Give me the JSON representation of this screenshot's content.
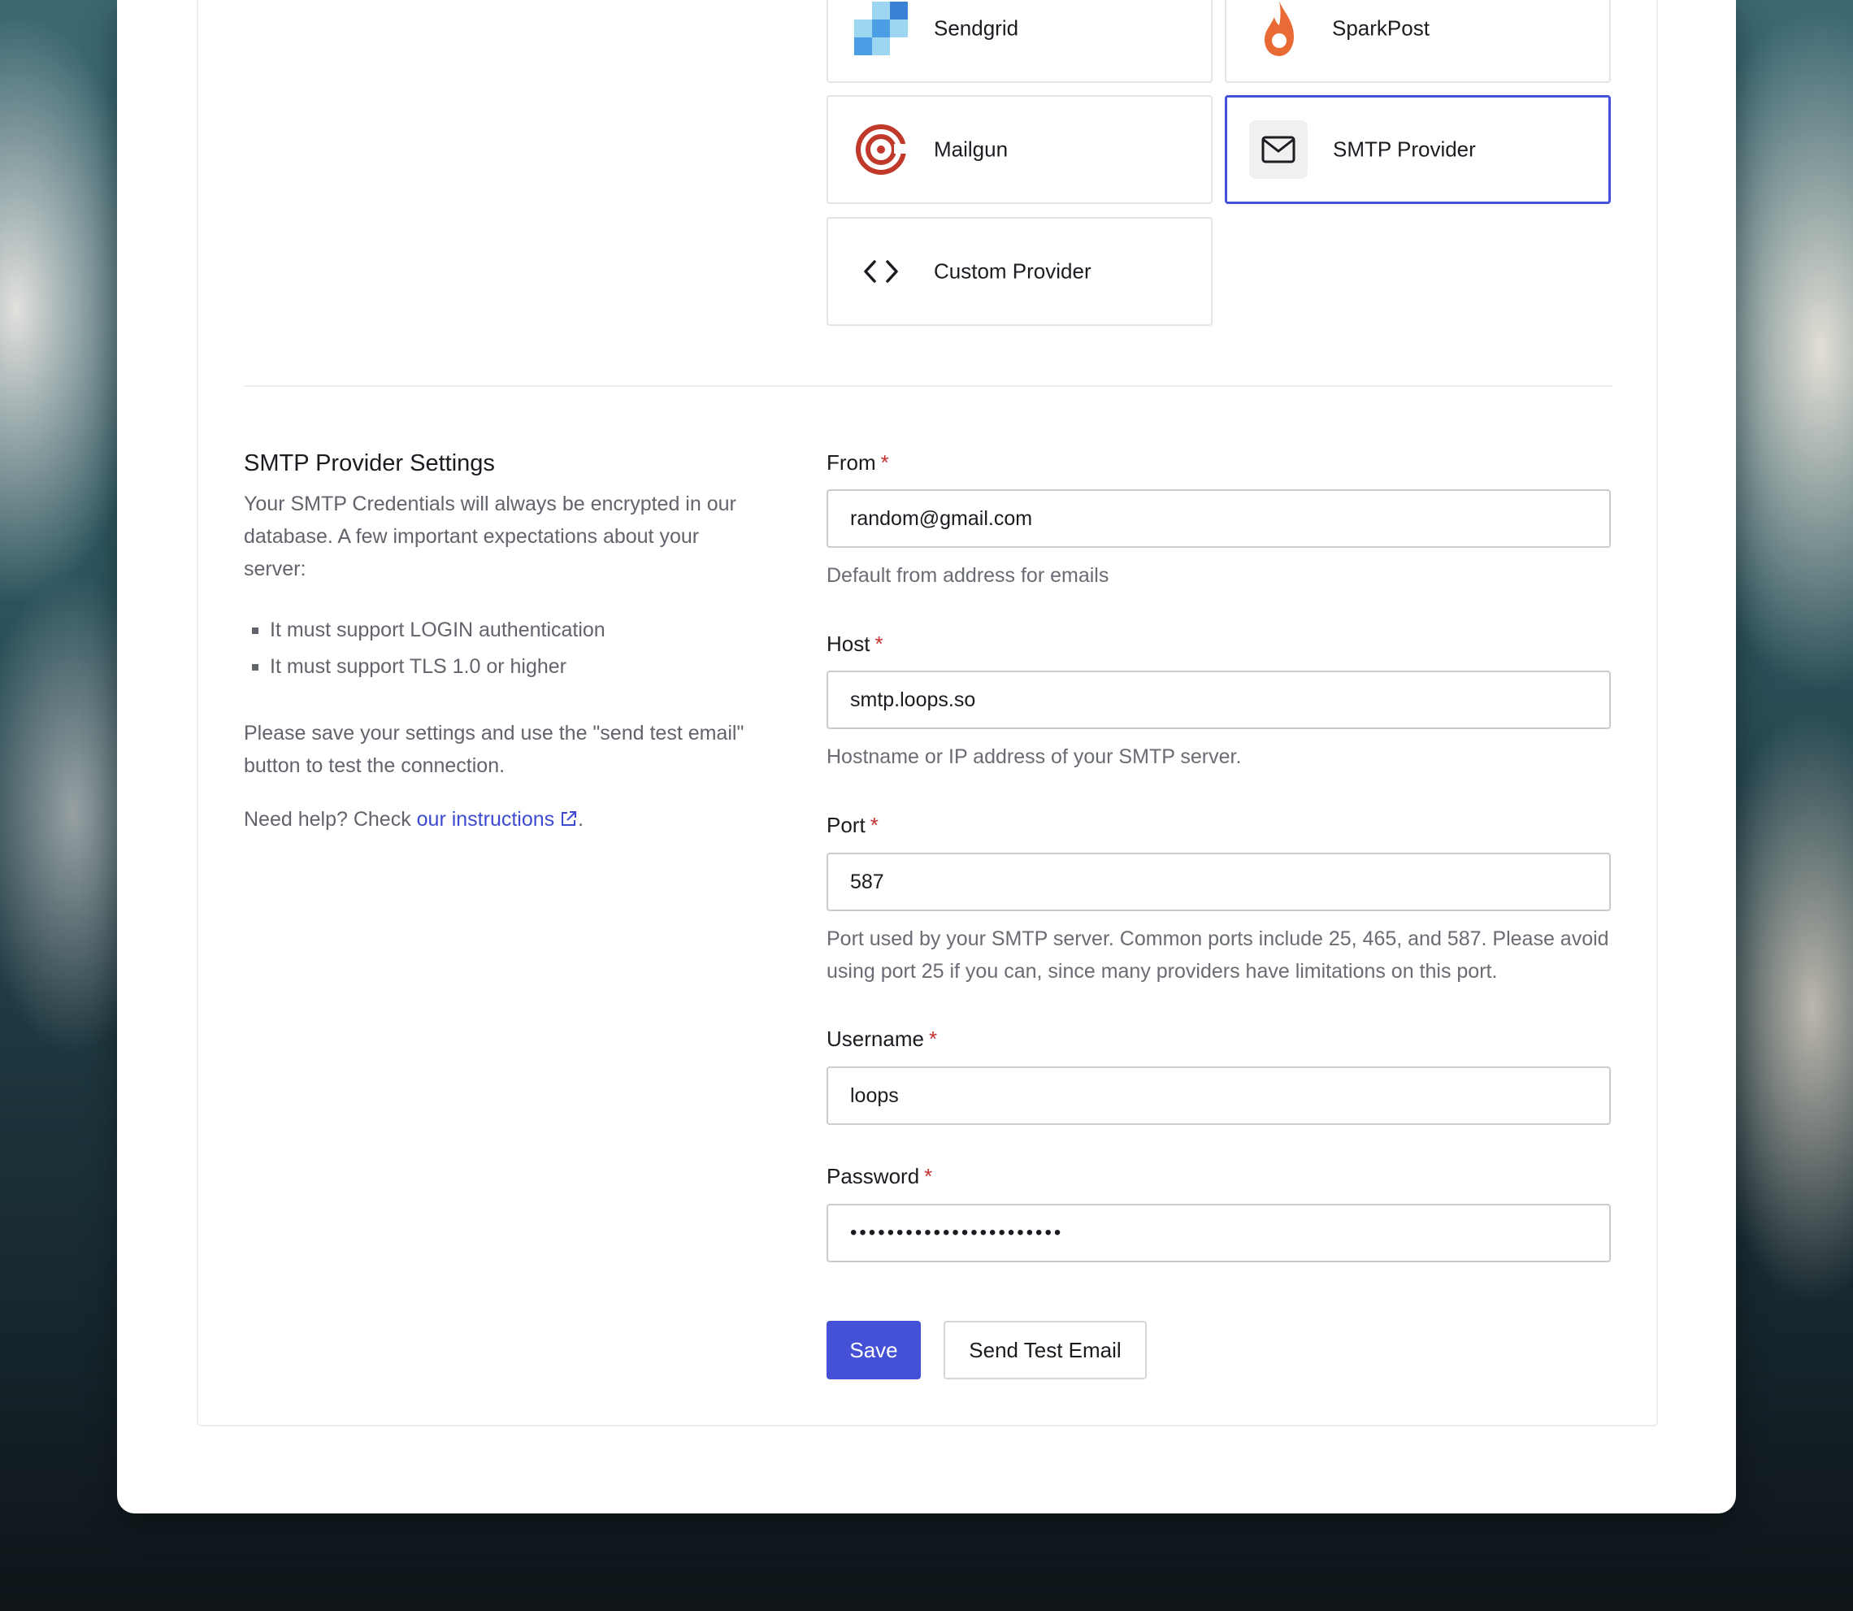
{
  "providers": [
    {
      "name": "Sendgrid",
      "icon": "sendgrid-logo-icon"
    },
    {
      "name": "SparkPost",
      "icon": "sparkpost-flame-icon"
    },
    {
      "name": "Mailgun",
      "icon": "mailgun-at-icon"
    },
    {
      "name": "SMTP Provider",
      "icon": "mail-envelope-icon",
      "selected": true
    },
    {
      "name": "Custom Provider",
      "icon": "code-brackets-icon"
    }
  ],
  "settings": {
    "title": "SMTP Provider Settings",
    "intro": "Your SMTP Credentials will always be encrypted in our database. A few important expectations about your server:",
    "bullets": [
      "It must support LOGIN authentication",
      "It must support TLS 1.0 or higher"
    ],
    "save_note": "Please save your settings and use the \"send test email\" button to test the connection.",
    "help_prefix": "Need help? Check ",
    "help_link": "our instructions",
    "help_suffix": "."
  },
  "form": {
    "required_mark": "*",
    "from": {
      "label": "From",
      "value": "random@gmail.com",
      "help": "Default from address for emails"
    },
    "host": {
      "label": "Host",
      "value": "smtp.loops.so",
      "help": "Hostname or IP address of your SMTP server."
    },
    "port": {
      "label": "Port",
      "value": "587",
      "help": "Port used by your SMTP server. Common ports include 25, 465, and 587. Please avoid using port 25 if you can, since many providers have limitations on this port."
    },
    "username": {
      "label": "Username",
      "value": "loops"
    },
    "password": {
      "label": "Password",
      "value": "•••••••••••••••••••••••"
    }
  },
  "buttons": {
    "save": "Save",
    "send_test": "Send Test Email"
  },
  "colors": {
    "accent": "#4451d6",
    "required": "#c53030",
    "link": "#3e4ad1"
  }
}
